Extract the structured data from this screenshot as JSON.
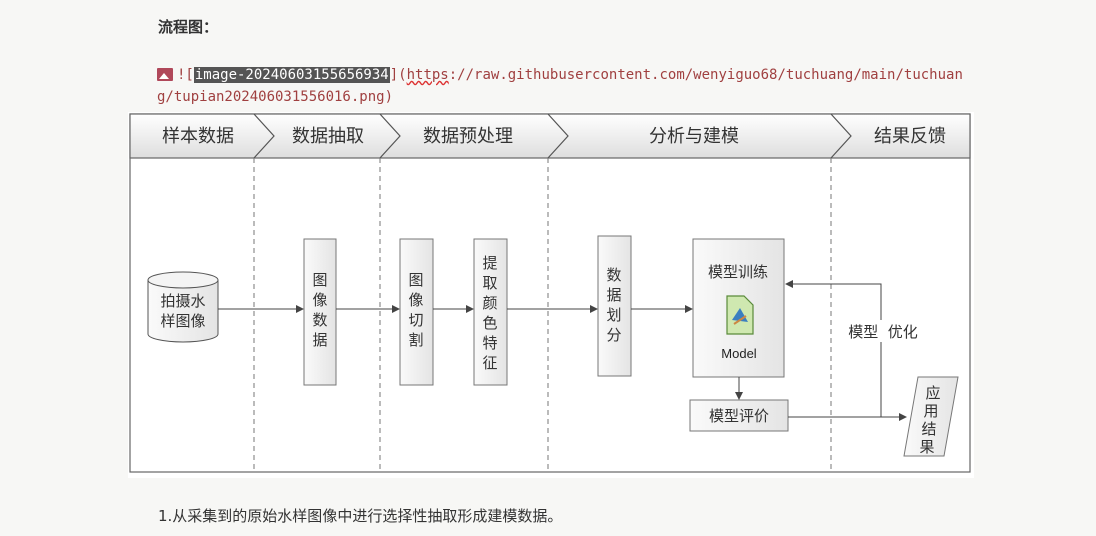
{
  "heading": "流程图：",
  "markdown_image": {
    "open": "![",
    "alt_text": "image-20240603155656934",
    "close_paren": "](",
    "url_scheme": "https",
    "url_rest_line1": "://raw.githubusercontent.com/wenyiguo68/tuchuang/main/tuchuan",
    "url_rest_line2": "g/tupian202406031556016.png)"
  },
  "diagram": {
    "stages": [
      "样本数据",
      "数据抽取",
      "数据预处理",
      "分析与建模",
      "结果反馈"
    ],
    "nodes": {
      "capture": [
        "拍摄水",
        "样图像"
      ],
      "image_data": [
        "图",
        "像",
        "数",
        "据"
      ],
      "image_cut": [
        "图",
        "像",
        "切",
        "割"
      ],
      "extract_color": [
        "提",
        "取",
        "颜",
        "色",
        "特",
        "征"
      ],
      "data_split": [
        "数",
        "据",
        "划",
        "分"
      ],
      "model_train": "模型训练",
      "model_label": "Model",
      "model_eval": "模型评价",
      "result": [
        "应",
        "用",
        "结",
        "果"
      ]
    },
    "optimize_label": "模型  优化"
  },
  "body_text": "1.从采集到的原始水样图像中进行选择性抽取形成建模数据。"
}
